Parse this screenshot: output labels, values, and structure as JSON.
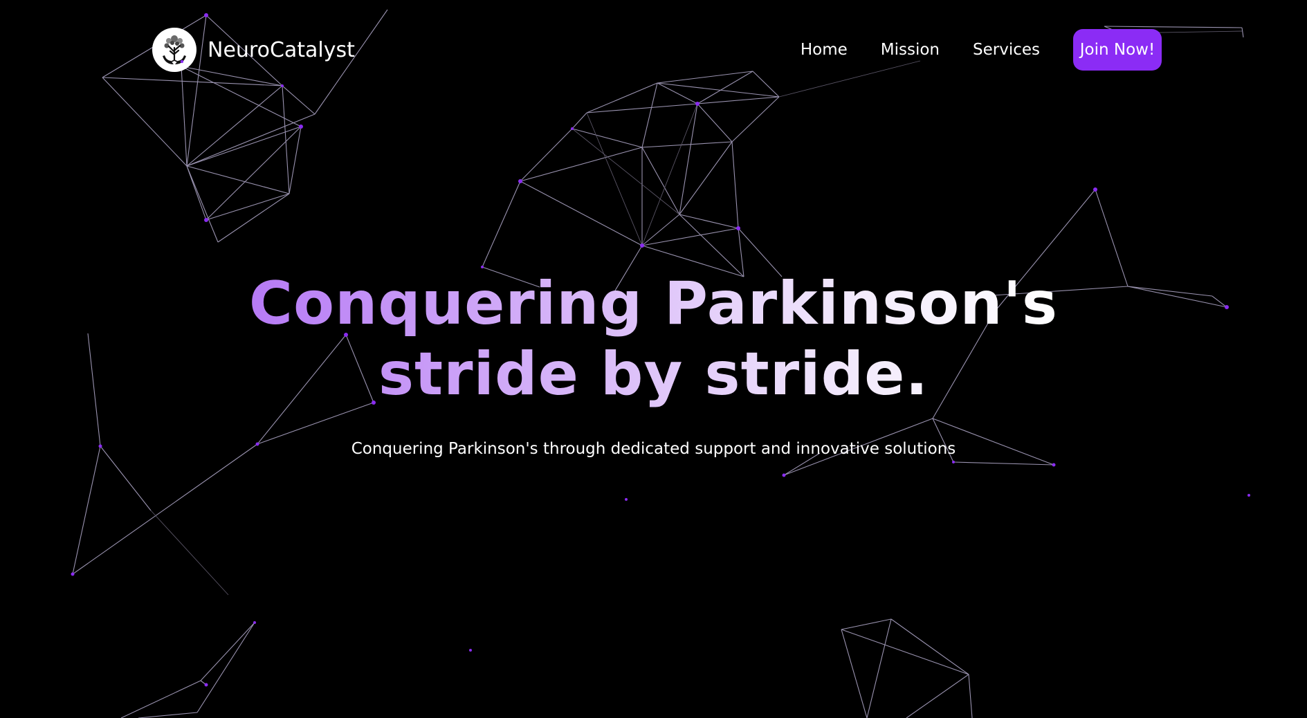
{
  "header": {
    "brand_name": "NeuroCatalyst",
    "nav": {
      "home": "Home",
      "mission": "Mission",
      "services": "Services",
      "join": "Join Now!"
    }
  },
  "hero": {
    "title": "Conquering Parkinson's stride by stride.",
    "subtitle": "Conquering Parkinson's through dedicated support and innovative solutions"
  },
  "colors": {
    "background": "#000000",
    "accent": "#8b2cf5",
    "node": "#8a2cf0",
    "title_gradient_start": "#b578f5",
    "title_gradient_end": "#ffffff"
  },
  "icons": {
    "logo": "tree-hands-logo-icon"
  }
}
